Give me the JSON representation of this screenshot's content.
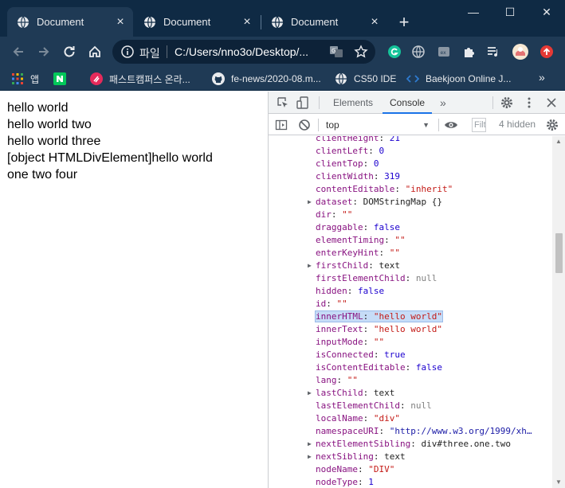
{
  "browser": {
    "tabs": [
      {
        "title": "Document",
        "active": true
      },
      {
        "title": "Document",
        "active": false
      },
      {
        "title": "Document",
        "active": false
      }
    ],
    "new_tab": "+",
    "window_controls": {
      "minimize": "—",
      "maximize": "☐",
      "close": "✕"
    },
    "omnibox": {
      "scheme_label": "파일",
      "url": "C:/Users/nno3o/Desktop/..."
    },
    "bookmarks": [
      {
        "label": "앱",
        "icon": "apps-grid-icon"
      },
      {
        "label": "",
        "icon": "naver-icon"
      },
      {
        "label": "패스트캠퍼스 온라...",
        "icon": "fastcampus-icon"
      },
      {
        "label": "fe-news/2020-08.m...",
        "icon": "github-icon"
      },
      {
        "label": "CS50 IDE",
        "icon": "globe-icon"
      },
      {
        "label": "Baekjoon Online J...",
        "icon": "code-icon"
      }
    ],
    "bookmarks_more": "»"
  },
  "page": {
    "lines": [
      "hello world",
      "hello world two",
      "hello world three",
      "[object HTMLDivElement]hello world",
      "one two four"
    ]
  },
  "devtools": {
    "tabs": [
      {
        "label": "Elements",
        "active": false
      },
      {
        "label": "Console",
        "active": true
      }
    ],
    "more_tabs": "»",
    "context": "top",
    "filter_placeholder": "Filter",
    "hidden_count": "4 hidden",
    "properties": [
      {
        "key": "clientHeight",
        "value": "21",
        "type": "num",
        "expandable": false
      },
      {
        "key": "clientLeft",
        "value": "0",
        "type": "num",
        "expandable": false
      },
      {
        "key": "clientTop",
        "value": "0",
        "type": "num",
        "expandable": false
      },
      {
        "key": "clientWidth",
        "value": "319",
        "type": "num",
        "expandable": false
      },
      {
        "key": "contentEditable",
        "value": "\"inherit\"",
        "type": "str",
        "expandable": false
      },
      {
        "key": "dataset",
        "value": "DOMStringMap {}",
        "type": "obj",
        "expandable": true
      },
      {
        "key": "dir",
        "value": "\"\"",
        "type": "str",
        "expandable": false
      },
      {
        "key": "draggable",
        "value": "false",
        "type": "num",
        "expandable": false
      },
      {
        "key": "elementTiming",
        "value": "\"\"",
        "type": "str",
        "expandable": false
      },
      {
        "key": "enterKeyHint",
        "value": "\"\"",
        "type": "str",
        "expandable": false
      },
      {
        "key": "firstChild",
        "value": "text",
        "type": "obj",
        "expandable": true
      },
      {
        "key": "firstElementChild",
        "value": "null",
        "type": "null",
        "expandable": false
      },
      {
        "key": "hidden",
        "value": "false",
        "type": "num",
        "expandable": false
      },
      {
        "key": "id",
        "value": "\"\"",
        "type": "str",
        "expandable": false
      },
      {
        "key": "innerHTML",
        "value": "\"hello world\"",
        "type": "str",
        "expandable": false,
        "selected": true
      },
      {
        "key": "innerText",
        "value": "\"hello world\"",
        "type": "str",
        "expandable": false
      },
      {
        "key": "inputMode",
        "value": "\"\"",
        "type": "str",
        "expandable": false
      },
      {
        "key": "isConnected",
        "value": "true",
        "type": "num",
        "expandable": false
      },
      {
        "key": "isContentEditable",
        "value": "false",
        "type": "num",
        "expandable": false
      },
      {
        "key": "lang",
        "value": "\"\"",
        "type": "str",
        "expandable": false
      },
      {
        "key": "lastChild",
        "value": "text",
        "type": "obj",
        "expandable": true
      },
      {
        "key": "lastElementChild",
        "value": "null",
        "type": "null",
        "expandable": false
      },
      {
        "key": "localName",
        "value": "\"div\"",
        "type": "str",
        "expandable": false
      },
      {
        "key": "namespaceURI",
        "value": "\"http://www.w3.org/1999/xh…",
        "type": "url",
        "expandable": false
      },
      {
        "key": "nextElementSibling",
        "value": "div#three.one.two",
        "type": "obj",
        "expandable": true
      },
      {
        "key": "nextSibling",
        "value": "text",
        "type": "obj",
        "expandable": true
      },
      {
        "key": "nodeName",
        "value": "\"DIV\"",
        "type": "str",
        "expandable": false
      },
      {
        "key": "nodeType",
        "value": "1",
        "type": "num",
        "expandable": false
      }
    ]
  },
  "colors": {
    "titlebar": "#0f2a44",
    "toolbar": "#1f3a55",
    "devtools_key": "#881280",
    "devtools_string": "#c41a16",
    "devtools_number": "#1c00cf",
    "selection": "#c6dcf7"
  }
}
